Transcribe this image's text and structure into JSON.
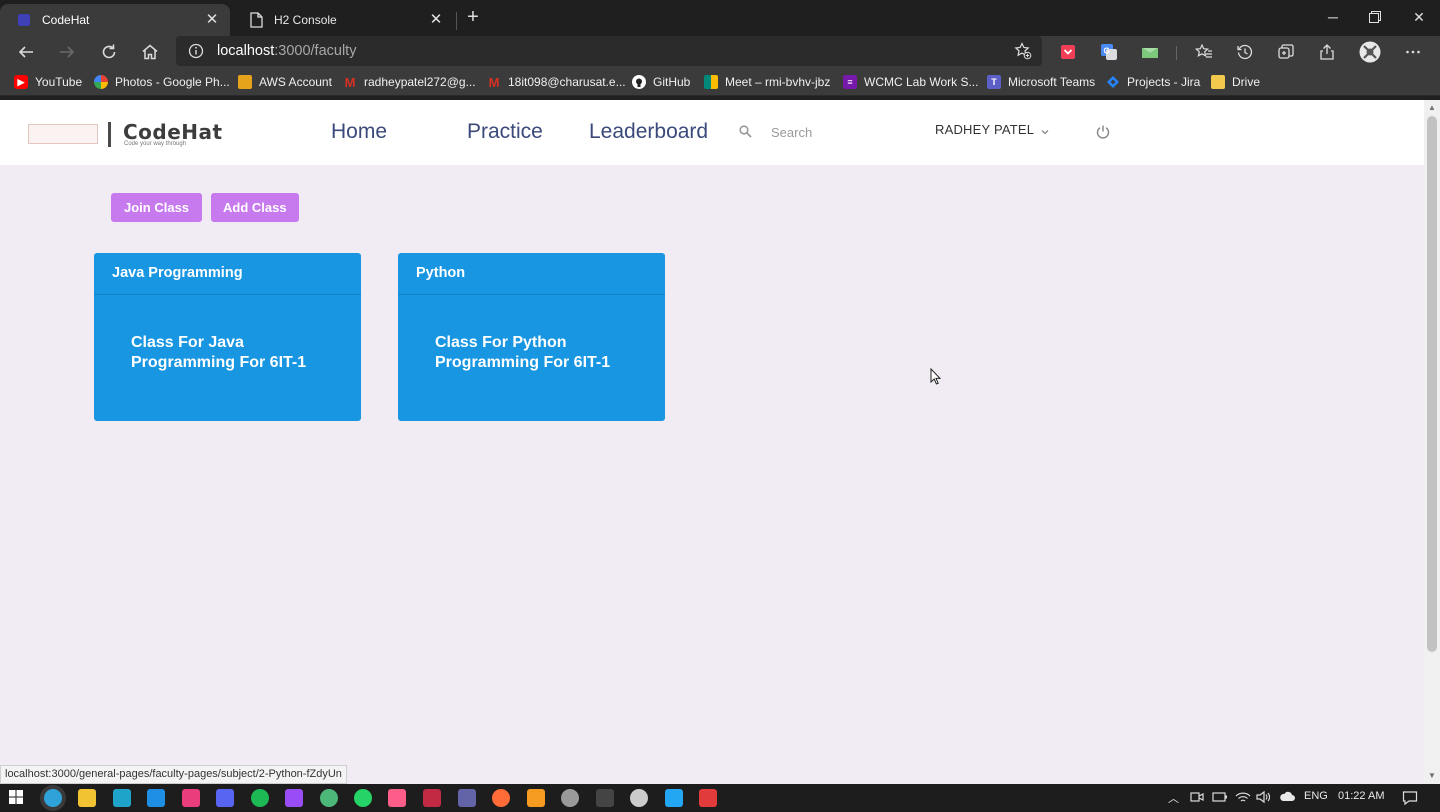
{
  "browser": {
    "tabs": [
      {
        "title": "CodeHat",
        "active": true
      },
      {
        "title": "H2 Console",
        "active": false
      }
    ],
    "address_host": "localhost",
    "address_path": ":3000/faculty",
    "bookmarks": [
      {
        "label": "YouTube",
        "icon": "youtube-icon",
        "color": "#ff0000"
      },
      {
        "label": "Photos - Google Ph...",
        "icon": "google-photos-icon",
        "color": "#fbbc04"
      },
      {
        "label": "AWS Account",
        "icon": "aws-icon",
        "color": "#e5a21b"
      },
      {
        "label": "radheypatel272@g...",
        "icon": "gmail-icon",
        "color": "#d93025"
      },
      {
        "label": "18it098@charusat.e...",
        "icon": "gmail-icon",
        "color": "#d93025"
      },
      {
        "label": "GitHub",
        "icon": "github-icon",
        "color": "#ffffff"
      },
      {
        "label": "Meet – rmi-bvhv-jbz",
        "icon": "google-meet-icon",
        "color": "#00897b"
      },
      {
        "label": "WCMC Lab Work S...",
        "icon": "onenote-icon",
        "color": "#7719aa"
      },
      {
        "label": "Microsoft Teams",
        "icon": "teams-icon",
        "color": "#5b5fc7"
      },
      {
        "label": "Projects - Jira",
        "icon": "jira-icon",
        "color": "#2684ff"
      },
      {
        "label": "Drive",
        "icon": "folder-icon",
        "color": "#f2c94c"
      }
    ],
    "status_url": "localhost:3000/general-pages/faculty-pages/subject/2-Python-fZdyUn"
  },
  "app": {
    "logo_name": "CodeHat",
    "logo_tagline": "Code your way through",
    "nav": {
      "home": "Home",
      "practice": "Practice",
      "leaderboard": "Leaderboard"
    },
    "search_placeholder": "Search",
    "user_name": "RADHEY PATEL",
    "buttons": {
      "join": "Join Class",
      "add": "Add Class"
    },
    "classes": [
      {
        "name": "Java Programming",
        "description": "Class For Java Programming For 6IT-1"
      },
      {
        "name": "Python",
        "description": "Class For Python Programming For 6IT-1"
      }
    ],
    "colors": {
      "accent_button": "#c779ee",
      "card": "#1896e2",
      "page_bg": "#f1ecf3",
      "nav_text": "#3b4a7a"
    }
  },
  "taskbar": {
    "apps": [
      {
        "icon": "windows-start-icon",
        "color": "#ffffff"
      },
      {
        "icon": "edge-icon",
        "color": "#2fa3d9"
      },
      {
        "icon": "file-explorer-icon",
        "color": "#f1c232"
      },
      {
        "icon": "l-app-icon",
        "color": "#1ea4c9"
      },
      {
        "icon": "mail-icon",
        "color": "#1f8fe5"
      },
      {
        "icon": "media-player-icon",
        "color": "#ea3d7b"
      },
      {
        "icon": "discord-icon",
        "color": "#5865f2"
      },
      {
        "icon": "spotify-icon",
        "color": "#1db954"
      },
      {
        "icon": "premiere-icon",
        "color": "#9a4cf6"
      },
      {
        "icon": "maps-icon",
        "color": "#4db77a"
      },
      {
        "icon": "whatsapp-icon",
        "color": "#25d366"
      },
      {
        "icon": "intellij-icon",
        "color": "#fc5d89"
      },
      {
        "icon": "brackets-icon",
        "color": "#c22a43"
      },
      {
        "icon": "teams-icon",
        "color": "#6264a7"
      },
      {
        "icon": "postman-icon",
        "color": "#ff6c37"
      },
      {
        "icon": "sublime-icon",
        "color": "#f49b20"
      },
      {
        "icon": "obs-icon",
        "color": "#9a9a9a"
      },
      {
        "icon": "terminal-icon",
        "color": "#444444"
      },
      {
        "icon": "github-desktop-icon",
        "color": "#cccccc"
      },
      {
        "icon": "vscode-icon",
        "color": "#23a7f2"
      },
      {
        "icon": "screen-recorder-icon",
        "color": "#e23b3b"
      }
    ],
    "language": "ENG",
    "time": "01:22 AM"
  }
}
